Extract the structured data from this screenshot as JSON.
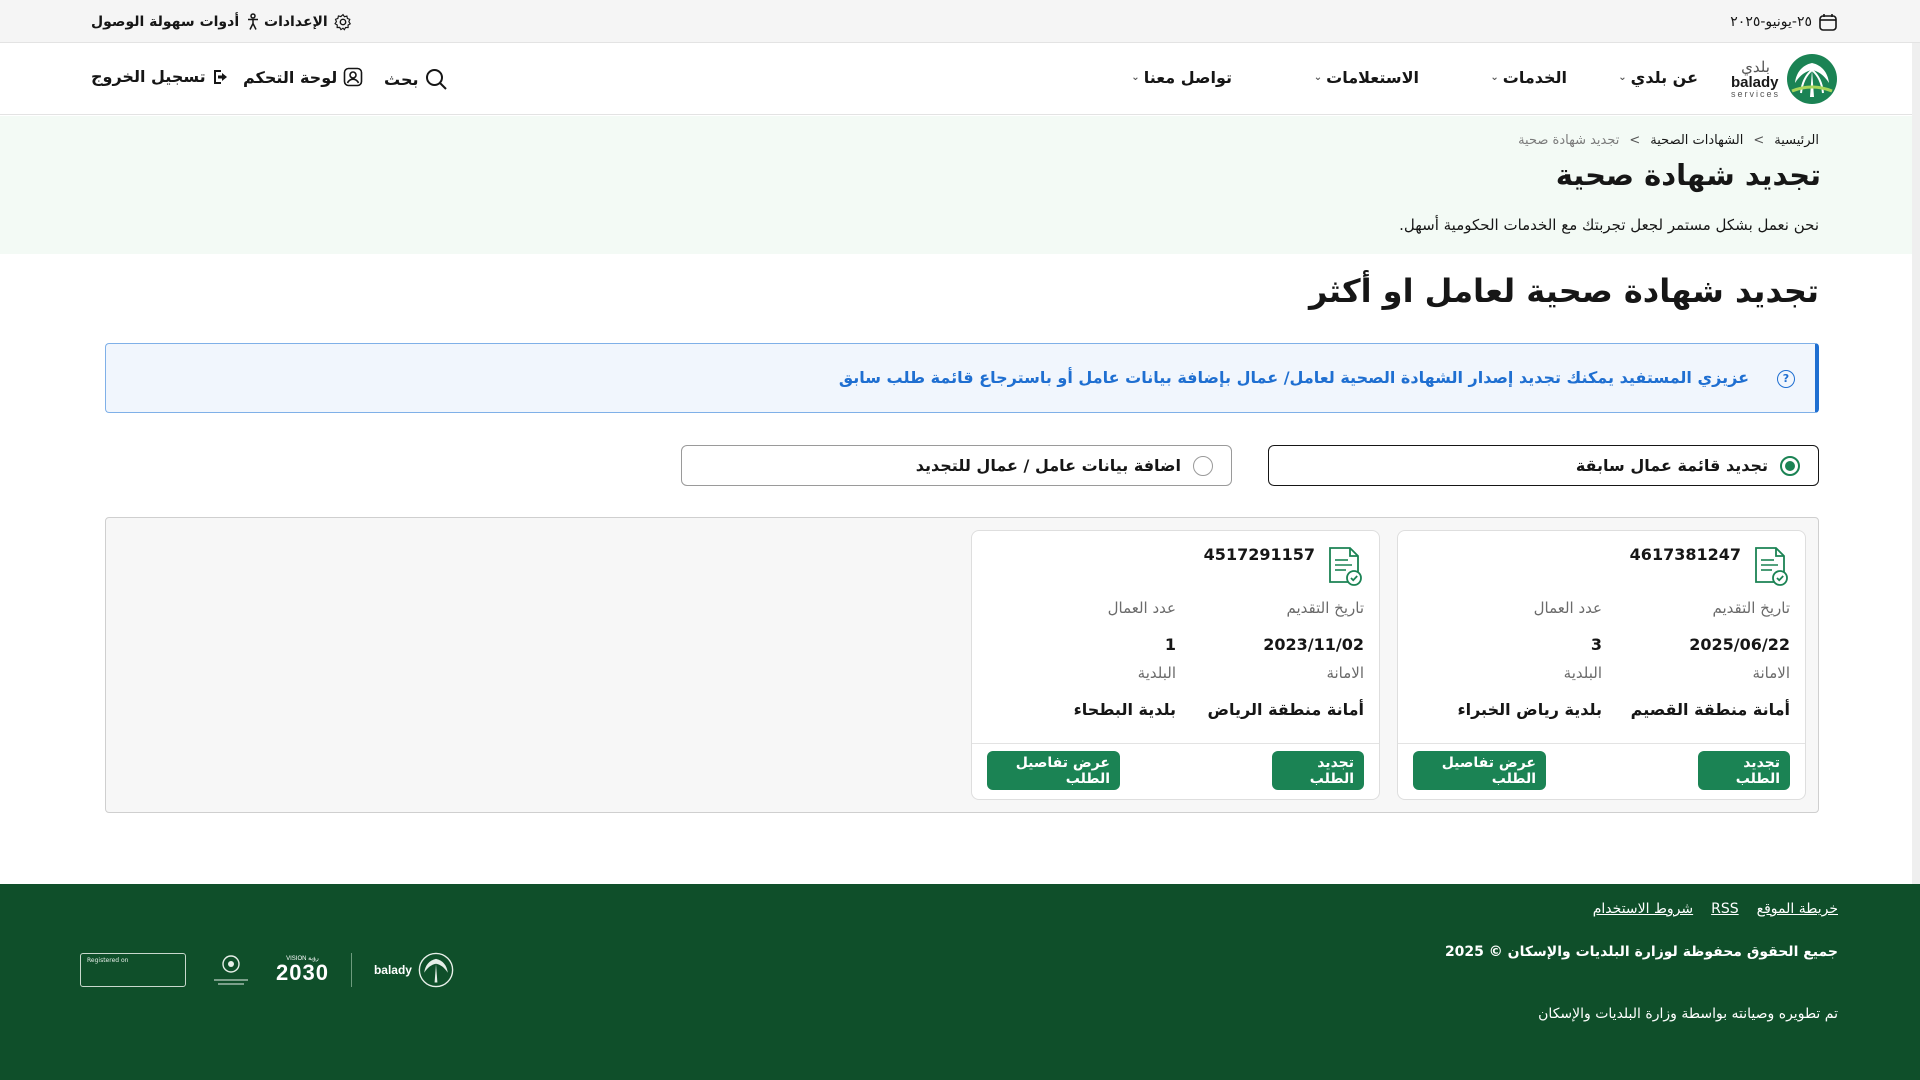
{
  "topbar": {
    "date": "٢٥-يونيو-٢٠٢٥",
    "settings_label": "الإعدادات",
    "accessibility_label": "أدوات سهولة الوصول"
  },
  "header": {
    "logo_ar": "بلدي",
    "logo_en": "balady",
    "logo_en2": "services",
    "nav": [
      {
        "label": "عن بلدي"
      },
      {
        "label": "الخدمات"
      },
      {
        "label": "الاستعلامات"
      },
      {
        "label": "تواصل معنا"
      }
    ],
    "search_label": "بحث",
    "dashboard_label": "لوحة التحكم",
    "logout_label": "تسجيل الخروج"
  },
  "hero": {
    "crumbs": [
      "الرئيسية",
      "الشهادات الصحية",
      "تجديد شهادة صحية"
    ],
    "crumb_sep": ">",
    "title": "تجديد شهادة صحية",
    "subtitle": "نحن نعمل بشكل مستمر لجعل تجربتك مع الخدمات الحكومية أسهل."
  },
  "main": {
    "title": "تجديد شهادة صحية لعامل او أكثر",
    "alert_icon": "?",
    "alert": "عزيزي المستفيد يمكنك تجديد إصدار الشهادة الصحية لعامل/ عمال بإضافة بيانات عامل أو باسترجاع قائمة طلب سابق",
    "options": [
      {
        "label": "تجديد قائمة عمال سابقة",
        "selected": true
      },
      {
        "label": "اضافة بيانات عامل / عمال للتجديد",
        "selected": false
      }
    ]
  },
  "cards": [
    {
      "number": "4617381247",
      "date_label": "تاريخ التقديم",
      "date": "2025/06/22",
      "workers_label": "عدد العمال",
      "workers": "3",
      "amana_label": "الامانة",
      "amana": "أمانة منطقة القصيم",
      "municipality_label": "البلدية",
      "municipality": "بلدية رياض الخبراء",
      "renew_label": "تجديد الطلب",
      "details_label": "عرض تفاصيل الطلب"
    },
    {
      "number": "4517291157",
      "date_label": "تاريخ التقديم",
      "date": "2023/11/02",
      "workers_label": "عدد العمال",
      "workers": "1",
      "amana_label": "الامانة",
      "amana": "أمانة منطقة الرياض",
      "municipality_label": "البلدية",
      "municipality": "بلدية البطحاء",
      "renew_label": "تجديد الطلب",
      "details_label": "عرض تفاصيل الطلب"
    }
  ],
  "footer": {
    "links": [
      "خريطة الموقع",
      "RSS",
      "شروط الاستخدام"
    ],
    "copyright": "جميع الحقوق محفوظة لوزارة البلديات والإسكان © 2025",
    "developed": "تم تطويره وصيانته بواسطة وزارة البلديات والإسكان",
    "vision_big": "2030",
    "vision_small": "VISION رؤية",
    "badge_left": "Registered on",
    "logo_en": "balady"
  },
  "colors": {
    "primary": "#1b8354",
    "info": "#1f6fd1",
    "footer_bg": "#0f4f2a",
    "hero_bg": "#f3faf5"
  }
}
